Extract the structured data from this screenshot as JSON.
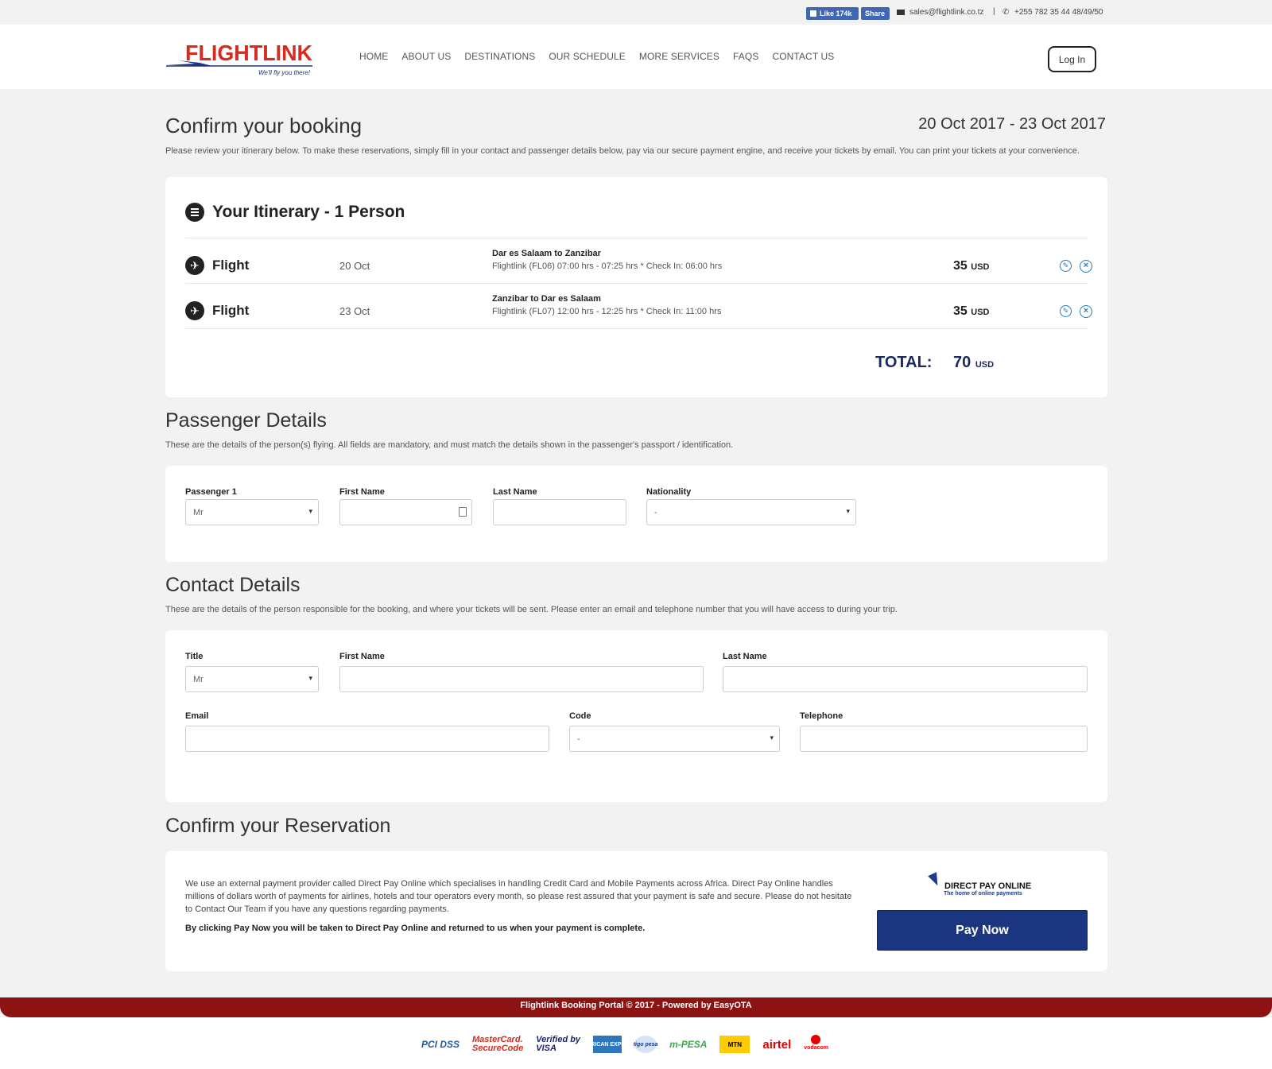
{
  "topbar": {
    "fb_like": "Like 174k",
    "fb_share": "Share",
    "email": "sales@flightlink.co.tz",
    "separator": "|",
    "phone": "+255 782 35 44 48/49/50"
  },
  "header": {
    "logo_text": "FLIGHTLINK",
    "logo_tagline": "We'll fly you there!",
    "nav": [
      "HOME",
      "ABOUT US",
      "DESTINATIONS",
      "OUR SCHEDULE",
      "MORE SERVICES",
      "FAQS",
      "CONTACT US"
    ],
    "login_label": "Log In"
  },
  "page": {
    "title": "Confirm your booking",
    "date_range": "20 Oct 2017 - 23 Oct 2017",
    "intro": "Please review your itinerary below. To make these reservations, simply fill in your contact and passenger details below, pay via our secure payment engine, and receive your tickets by email. You can print your tickets at your convenience."
  },
  "itinerary": {
    "title": "Your Itinerary - 1 Person",
    "rows": [
      {
        "type": "Flight",
        "date": "20 Oct",
        "route": "Dar es Salaam to Zanzibar",
        "detail": "Flightlink (FL06) 07:00 hrs - 07:25 hrs * Check In: 06:00 hrs",
        "price": "35",
        "currency": "USD"
      },
      {
        "type": "Flight",
        "date": "23 Oct",
        "route": "Zanzibar to Dar es Salaam",
        "detail": "Flightlink (FL07) 12:00 hrs - 12:25 hrs * Check In: 11:00 hrs",
        "price": "35",
        "currency": "USD"
      }
    ],
    "total_label": "TOTAL:",
    "total_value": "70",
    "total_currency": "USD"
  },
  "passenger": {
    "title": "Passenger Details",
    "description": "These are the details of the person(s) flying. All fields are mandatory, and must match the details shown in the passenger's passport / identification.",
    "label_passenger": "Passenger 1",
    "label_first": "First Name",
    "label_last": "Last Name",
    "label_nationality": "Nationality",
    "title_value": "Mr",
    "first_value": "",
    "last_value": "",
    "nationality_value": "-"
  },
  "contact": {
    "title": "Contact Details",
    "description": "These are the details of the person responsible for the booking, and where your tickets will be sent. Please enter an email and telephone number that you will have access to during your trip.",
    "label_title": "Title",
    "label_first": "First Name",
    "label_last": "Last Name",
    "label_email": "Email",
    "label_code": "Code",
    "label_telephone": "Telephone",
    "title_value": "Mr",
    "first_value": "",
    "last_value": "",
    "email_value": "",
    "code_value": "-",
    "telephone_value": ""
  },
  "confirm": {
    "title": "Confirm your Reservation",
    "text": "We use an external payment provider called Direct Pay Online which specialises in handling Credit Card and Mobile Payments across Africa. Direct Pay Online handles millions of dollars worth of payments for airlines, hotels and tour operators every month, so please rest assured that your payment is safe and secure. Please do not hesitate to Contact Our Team if you have any questions regarding payments.",
    "note": "By clicking Pay Now you will be taken to Direct Pay Online and returned to us when your payment is complete.",
    "dpo_brand": "DIRECT PAY ONLINE",
    "dpo_tagline": "The home of online payments",
    "pay_button": "Pay Now"
  },
  "footer": {
    "text": "Flightlink Booking Portal © 2017 - Powered by EasyOTA",
    "payment_logos": {
      "pci": "PCI DSS",
      "mc1": "MasterCard.",
      "mc2": "SecureCode",
      "visa1": "Verified by",
      "visa2": "VISA",
      "amex": "AMERICAN EXPRESS",
      "tigo": "tigo pesa",
      "mpesa": "m-PESA",
      "mtn": "MTN",
      "airtel": "airtel",
      "voda": "vodacom"
    }
  },
  "colors": {
    "brand_red": "#d62b1f",
    "navy": "#1b3580",
    "footer_red": "#8d1313",
    "link_blue": "#2a7ab8"
  }
}
